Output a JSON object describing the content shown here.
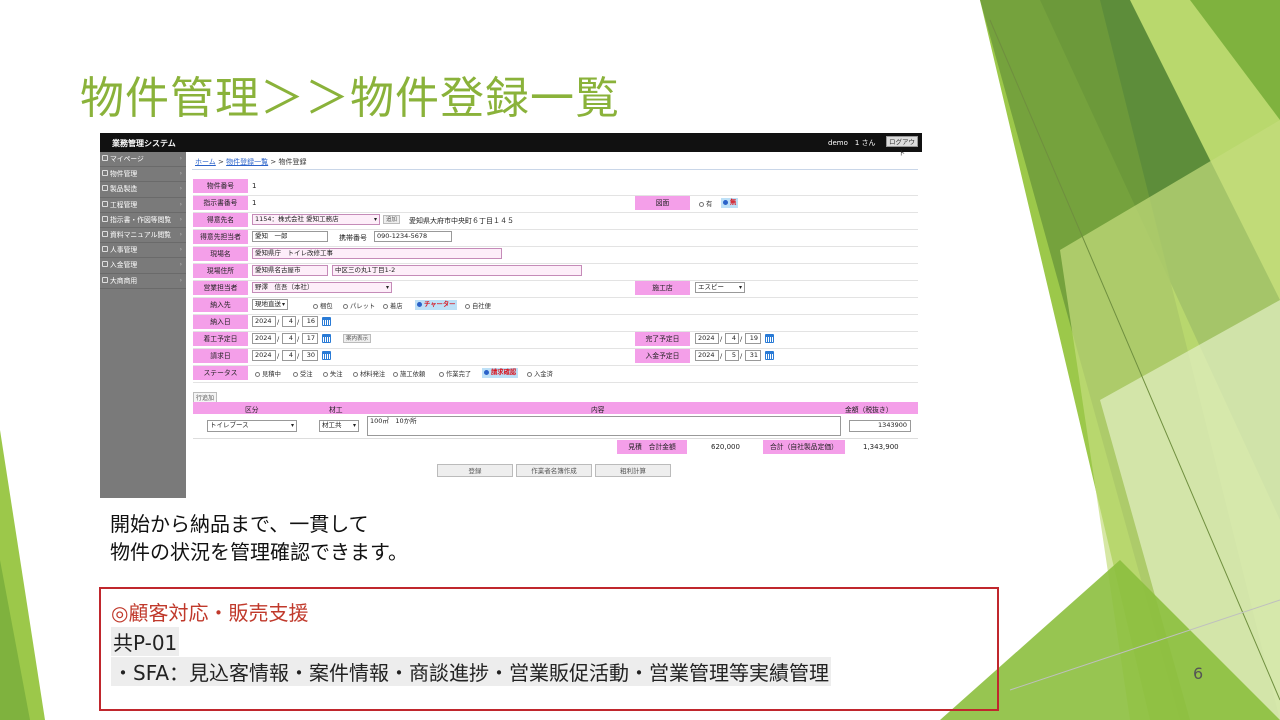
{
  "slide": {
    "title": "物件管理＞＞物件登録一覧",
    "caption_line1": "開始から納品まで、一貫して",
    "caption_line2": "物件の状況を管理確認できます。",
    "page_number": "6",
    "callout": {
      "line1": "◎顧客対応・販売支援",
      "line2": "共P-01",
      "line3": "・SFA：見込客情報・案件情報・商談進捗・営業販促活動・営業管理等実績管理"
    },
    "colors": {
      "accent_green": "#8ab23a",
      "label_pink": "#f49fe9",
      "callout_border": "#c0272d"
    }
  },
  "app": {
    "system_name": "業務管理システム",
    "user": "demo　1 さん",
    "logout": "ログアウト",
    "sidebar": [
      {
        "label": "マイページ"
      },
      {
        "label": "物件管理"
      },
      {
        "label": "製品製造"
      },
      {
        "label": "工程管理"
      },
      {
        "label": "指示書・作図等閲覧"
      },
      {
        "label": "資料マニュアル閲覧"
      },
      {
        "label": "人事管理"
      },
      {
        "label": "入金管理"
      },
      {
        "label": "大商商用"
      }
    ],
    "breadcrumb": {
      "home": "ホーム",
      "sep1": ">",
      "list": "物件登録一覧",
      "sep2": ">",
      "current": "物件登録"
    },
    "form": {
      "property_no_label": "物件番号",
      "property_no": "1",
      "instruction_no_label": "指示書番号",
      "instruction_no": "1",
      "drawing_label": "図面",
      "drawing_opt1": "有",
      "drawing_opt2": "無",
      "client_label": "得意先名",
      "client_value": "1154：株式会社 愛知工務店",
      "client_btn": "追加",
      "client_address": "愛知県大府市中央町６丁目１４５",
      "contact_label": "得意先担当者",
      "contact_value": "愛知　一郎",
      "mobile_label": "携帯番号",
      "mobile_value": "090-1234-5678",
      "site_name_label": "現場名",
      "site_name": "愛知県庁　トイレ改修工事",
      "site_addr_label": "現場住所",
      "site_city": "愛知県名古屋市",
      "site_addr": "中区三の丸1丁目1-2",
      "sales_label": "営業担当者",
      "sales_value": "野澤　信吾（本社）",
      "contractor_label": "施工店",
      "contractor_value": "エスピー",
      "delivery_label": "納入先",
      "delivery_select": "現地直送",
      "delivery_opts": [
        "梱包",
        "パレット",
        "着店",
        "チャーター",
        "自社便"
      ],
      "delivery_selected": "チャーター",
      "delivery_date_label": "納入日",
      "delivery_date": {
        "y": "2024",
        "m": "4",
        "d": "16"
      },
      "start_label": "着工予定日",
      "start_date": {
        "y": "2024",
        "m": "4",
        "d": "17"
      },
      "start_btn": "案内表示",
      "finish_label": "完了予定日",
      "finish_date": {
        "y": "2024",
        "m": "4",
        "d": "19"
      },
      "billing_label": "請求日",
      "billing_date": {
        "y": "2024",
        "m": "4",
        "d": "30"
      },
      "payment_label": "入金予定日",
      "payment_date": {
        "y": "2024",
        "m": "5",
        "d": "31"
      },
      "status_label": "ステータス",
      "status_opts": [
        "見積中",
        "受注",
        "失注",
        "材料発注",
        "施工依頼",
        "作業完了",
        "請求確認",
        "入金済"
      ],
      "status_selected": "請求確認"
    },
    "items": {
      "add_label": "行追加",
      "headers": {
        "category": "区分",
        "material": "材工",
        "content": "内容",
        "amount": "金額（税抜き）"
      },
      "row": {
        "category": "トイレブース",
        "material": "材工共",
        "content": "100㎡　10か所",
        "amount": "1343900"
      },
      "estimate_label": "見積　合計金額",
      "estimate_value": "620,000",
      "total_label": "合計（自社製品定価）",
      "total_value": "1,343,900"
    },
    "buttons": {
      "register": "登録",
      "worker": "作業者名簿作成",
      "calc": "粗利計算"
    }
  }
}
